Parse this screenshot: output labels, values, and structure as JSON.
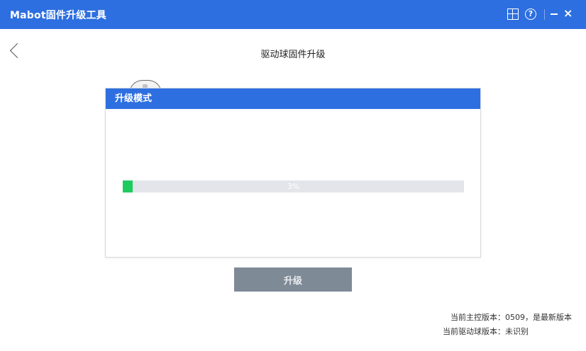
{
  "window": {
    "title": "Mabot固件升级工具",
    "close_glyph": "×",
    "help_glyph": "?"
  },
  "icons": {
    "grid": "grid-icon",
    "help": "help-icon",
    "minimize": "minimize-icon",
    "close": "close-icon",
    "back": "back-arrow-icon",
    "device": "drive-ball-icon"
  },
  "colors": {
    "accent": "#2d6fe0",
    "progress_fill": "#1ecb5e",
    "progress_track": "#e3e5ea",
    "button_disabled": "#7f8a97"
  },
  "page": {
    "title": "驱动球固件升级"
  },
  "dialog": {
    "title": "升级模式",
    "progress": {
      "percent": 3,
      "text": "3%"
    }
  },
  "actions": {
    "upgrade_label": "升级"
  },
  "status": {
    "main_version_label": "当前主控版本：",
    "main_version_value": "0509，是最新版本",
    "drive_version_label": "当前驱动球版本：",
    "drive_version_value": "未识别"
  }
}
